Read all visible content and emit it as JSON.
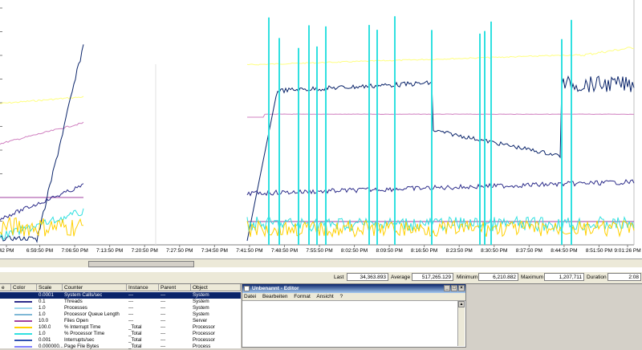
{
  "x_axis": {
    "ticks": [
      "42 PM",
      "6:59:50 PM",
      "7:06:50 PM",
      "7:13:50 PM",
      "7:20:50 PM",
      "7:27:50 PM",
      "7:34:50 PM",
      "7:41:50 PM",
      "7:48:50 PM",
      "7:55:50 PM",
      "8:02:50 PM",
      "8:09:50 PM",
      "8:16:50 PM",
      "8:23:50 PM",
      "8:30:50 PM",
      "8:37:50 PM",
      "8:44:50 PM",
      "8:51:50 PM",
      "9:01:26 PM"
    ]
  },
  "stats": {
    "last_label": "Last",
    "last_value": "34,363.893",
    "average_label": "Average",
    "average_value": "517,265.129",
    "minimum_label": "Minimum",
    "minimum_value": "6,210.882",
    "maximum_label": "Maximum",
    "maximum_value": "1,207,711",
    "duration_label": "Duration",
    "duration_value": "2:08"
  },
  "counter_table": {
    "headers": [
      "e",
      "Color",
      "Scale",
      "Counter",
      "Instance",
      "Parent",
      "Object"
    ],
    "rows": [
      {
        "scale": "0.0001",
        "counter": "System Calls/sec",
        "instance": "---",
        "parent": "---",
        "object": "System",
        "color": "#0a246a",
        "selected": true
      },
      {
        "scale": "0.1",
        "counter": "Threads",
        "instance": "---",
        "parent": "---",
        "object": "System",
        "color": "#2c2c8a"
      },
      {
        "scale": "1.0",
        "counter": "Processes",
        "instance": "---",
        "parent": "---",
        "object": "System",
        "color": "#9fd8ec"
      },
      {
        "scale": "1.0",
        "counter": "Processor Queue Length",
        "instance": "---",
        "parent": "---",
        "object": "System",
        "color": "#7fb8d6"
      },
      {
        "scale": "10.0",
        "counter": "Files Open",
        "instance": "---",
        "parent": "---",
        "object": "Server",
        "color": "#a040a0"
      },
      {
        "scale": "100.0",
        "counter": "% Interrupt Time",
        "instance": "_Total",
        "parent": "---",
        "object": "Processor",
        "color": "#ffd000"
      },
      {
        "scale": "1.0",
        "counter": "% Processor Time",
        "instance": "_Total",
        "parent": "---",
        "object": "Processor",
        "color": "#30e0e0"
      },
      {
        "scale": "0.001",
        "counter": "Interrupts/sec",
        "instance": "_Total",
        "parent": "---",
        "object": "Processor",
        "color": "#3050b0"
      },
      {
        "scale": "0.000000...",
        "counter": "Page File Bytes",
        "instance": "_Total",
        "parent": "---",
        "object": "Process",
        "color": "#8080ff"
      }
    ]
  },
  "editor": {
    "title": "Unbenannt - Editor",
    "menu": [
      "Datei",
      "Bearbeiten",
      "Format",
      "Ansicht",
      "?"
    ]
  }
}
